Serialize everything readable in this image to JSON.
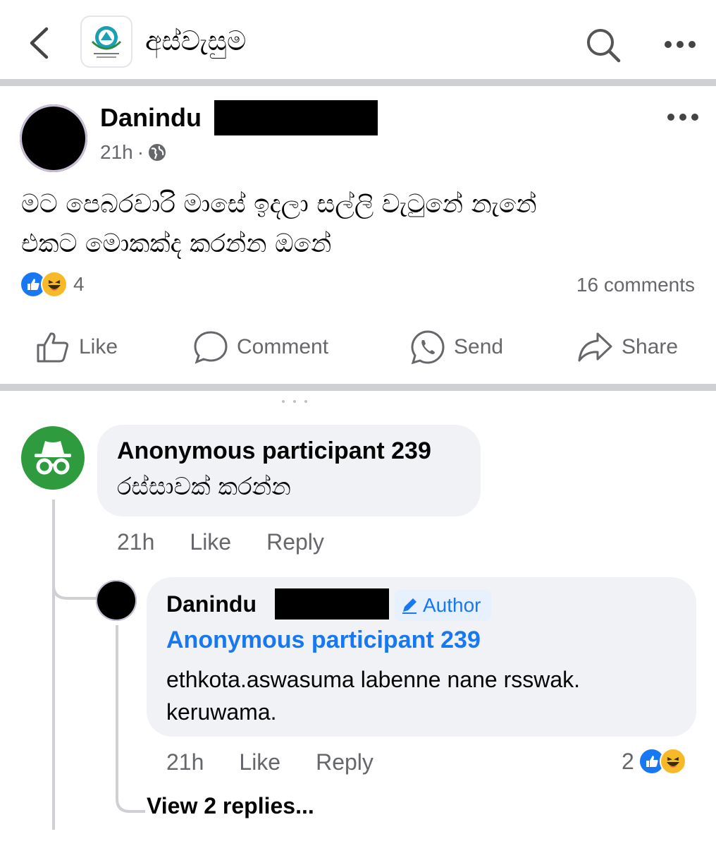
{
  "header": {
    "group_name": "අස්වැසුම",
    "logo_text": "අස්වැසුම"
  },
  "post": {
    "author_first_name": "Danindu",
    "time": "21h",
    "separator": "·",
    "privacy": "globe-icon",
    "text_line1": "මට  පෙබරවාරි  මාසේ ඉදලා සල්ලි වැටුනේ නැනේ",
    "text_line2": "එකට මොකක්ද කරන්න ඔනේ",
    "reaction_count": "4",
    "reaction_types": [
      "like",
      "haha"
    ],
    "comments_count": "16 comments"
  },
  "actions": {
    "like": "Like",
    "comment": "Comment",
    "send": "Send",
    "share": "Share"
  },
  "comments": [
    {
      "author": "Anonymous participant 239",
      "text": "රස්සාවක් කරන්න",
      "time": "21h",
      "like": "Like",
      "reply": "Reply"
    },
    {
      "author_first_name": "Danindu",
      "badge": "Author",
      "mention": "Anonymous participant 239",
      "text_line1": "ethkota.aswasuma labenne nane rsswak.",
      "text_line2": "keruwama.",
      "time": "21h",
      "like": "Like",
      "reply": "Reply",
      "reaction_count": "2",
      "reaction_types": [
        "like",
        "haha"
      ],
      "view_replies": "View 2 replies..."
    }
  ],
  "colors": {
    "accent_blue": "#1877f2",
    "anon_green": "#2e9c3e",
    "secondary_text": "#65676b",
    "bubble_bg": "#f0f2f5"
  }
}
